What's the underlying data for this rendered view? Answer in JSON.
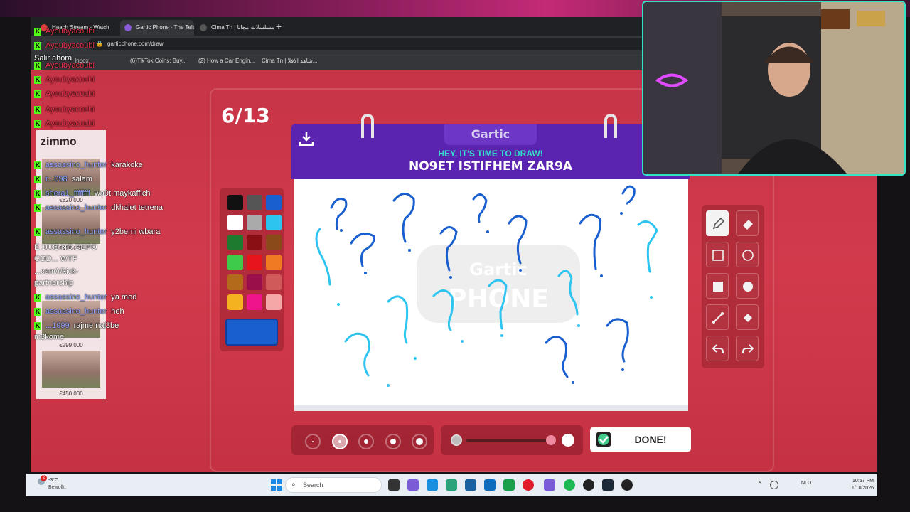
{
  "browser": {
    "tabs": [
      {
        "label": "Haach Stream - Watch"
      },
      {
        "label": "Gartic Phone - The Teleph"
      },
      {
        "label": "Cima Tn | المسلسلات مجانا"
      }
    ],
    "new_tab": "+",
    "url": "garticphone.com/draw",
    "bookmarks": [
      "Inbox",
      "(6)TikTok Coins: Buy...",
      "(2) How a Car Engin...",
      "Cima Tn | شاهد الافلا..."
    ]
  },
  "game": {
    "round": "6/13",
    "logo": "Gartic",
    "watermark_top": "Gartic",
    "watermark_bottom": "PHONE",
    "prompt_heading": "HEY, IT'S TIME TO DRAW!",
    "prompt_phrase": "NO9ET ISTIFHEM ZAR9A",
    "done_label": "DONE!",
    "palette": [
      "#111111",
      "#555555",
      "#1a5fd0",
      "#ffffff",
      "#aaaaaa",
      "#2ec4f0",
      "#1e7a2e",
      "#8a0f14",
      "#8a4a1a",
      "#3ecb4a",
      "#e8141c",
      "#f07a24",
      "#b36a1a",
      "#9a0f4a",
      "#d05a5a",
      "#f5b220",
      "#f0148a",
      "#f5a6a6"
    ],
    "selected_color": "#1a5fd0",
    "brush_sizes": 5,
    "selected_brush_size_index": 1,
    "opacity": 1.0,
    "tools": [
      "pen-icon",
      "eraser-icon",
      "rectangle-outline-icon",
      "circle-outline-icon",
      "rectangle-filled-icon",
      "circle-filled-icon",
      "line-icon",
      "fill-bucket-icon",
      "undo-icon",
      "redo-icon"
    ],
    "colors": {
      "stroke_dark": "#1a5fd0",
      "stroke_light": "#2ec4f0",
      "header": "#5b24b0",
      "accent": "#33e0d0"
    }
  },
  "chat": {
    "messages": [
      {
        "user": "Ayoubyacoubi",
        "text": ""
      },
      {
        "user": "Ayoubyacoubi",
        "text": ""
      },
      {
        "user": "",
        "text": "Salir ahora"
      },
      {
        "user": "Ayoubyacoubi",
        "text": ""
      },
      {
        "user": "Ayoubyacoubi",
        "text": ""
      },
      {
        "user": "Ayoubyacoubi",
        "text": ""
      },
      {
        "user": "Ayoubyacoubi",
        "text": ""
      },
      {
        "user": "Ayoubyacoubi",
        "text": ""
      },
      {
        "user": "assassino_hunter",
        "text": "karakoke"
      },
      {
        "user": "r...098",
        "text": "salam"
      },
      {
        "user": "shera1_ffffffff",
        "text": "wa9t maykaffich"
      },
      {
        "user": "assassino_hunter",
        "text": "dkhalet tetrena"
      },
      {
        "user": "assassino_hunter",
        "text": "y2berni wbara"
      },
      {
        "user": "",
        "text": "E 100$ NO DEPO"
      },
      {
        "user": "",
        "text": "COD... WTF"
      },
      {
        "user": "",
        "text": "...com/r/kick-"
      },
      {
        "user": "",
        "text": "partnership"
      },
      {
        "user": "assassino_hunter",
        "text": "ya mod"
      },
      {
        "user": "assassino_hunter",
        "text": "heh"
      },
      {
        "user": "...1999",
        "text": "rajme nal3be"
      },
      {
        "user": "",
        "text": "m3kome"
      }
    ],
    "badge_letter": "K",
    "zimmo": "zimmo",
    "listing_prices": [
      "€820.000",
      "€435.000",
      "€299.000",
      "€450.000"
    ]
  },
  "taskbar": {
    "weather_temp": "-3°C",
    "weather_text": "Bewolkt",
    "weather_badge": "2",
    "search_placeholder": "Search",
    "lang": "NLD",
    "time": "10:57 PM",
    "date": "1/10/2026"
  }
}
